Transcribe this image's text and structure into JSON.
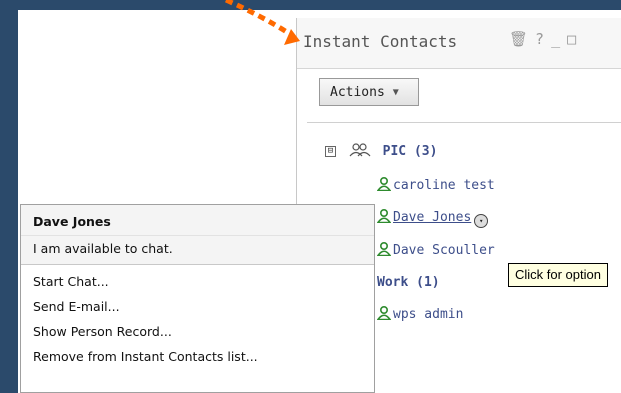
{
  "portlet": {
    "title": "Instant Contacts",
    "header_icons": [
      "trash-icon",
      "help-icon",
      "minimize-icon",
      "maximize-icon"
    ],
    "header_glyphs": {
      "trash": "🗑",
      "help": "?",
      "minimize": "_",
      "maximize": "□"
    },
    "actions_label": "Actions",
    "actions_arrow": "▼"
  },
  "tree": {
    "groups": [
      {
        "label": "PIC (3)",
        "expanded": true,
        "toggle": "⊟",
        "contacts": [
          "caroline test",
          "Dave Jones",
          "Dave Scouller"
        ]
      },
      {
        "label": "Work (1)",
        "contacts": [
          "wps admin"
        ]
      }
    ],
    "hover_button_glyph": "▾"
  },
  "tooltip": {
    "text": "Click for option"
  },
  "context_menu": {
    "name": "Dave Jones",
    "status": "I am available to chat.",
    "items": [
      "Start Chat...",
      "Send E-mail...",
      "Show Person Record...",
      "Remove from Instant Contacts list..."
    ]
  },
  "colors": {
    "background": "#2b4a6b",
    "contact_link": "#3d4e8a",
    "online_icon": "#2e8b2e",
    "pointer_arrow": "#ff6a00",
    "tooltip_bg": "#ffffe1"
  }
}
